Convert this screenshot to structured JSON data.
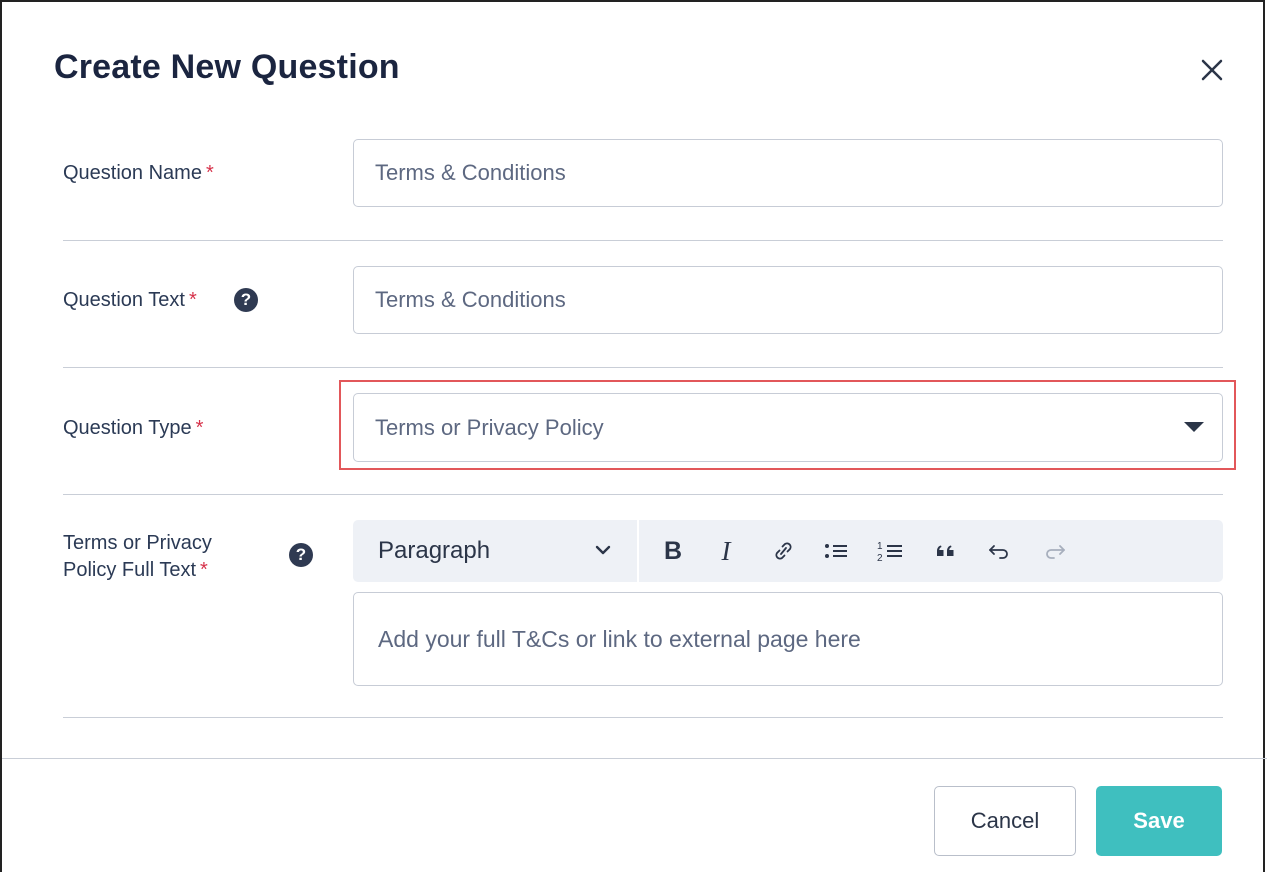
{
  "modal": {
    "title": "Create New Question"
  },
  "fields": {
    "question_name": {
      "label": "Question Name",
      "required": "*",
      "value": "Terms & Conditions"
    },
    "question_text": {
      "label": "Question Text",
      "required": "*",
      "help": "?",
      "value": "Terms & Conditions"
    },
    "question_type": {
      "label": "Question Type",
      "required": "*",
      "value": "Terms or Privacy Policy"
    },
    "full_text": {
      "label_line1": "Terms or Privacy",
      "label_line2": "Policy Full Text",
      "required": "*",
      "help": "?",
      "placeholder": "Add your full T&Cs or link to external page here"
    }
  },
  "toolbar": {
    "block_format": "Paragraph",
    "bold": "B",
    "italic": "I",
    "icons": [
      "chevron-down-icon",
      "bold-icon",
      "italic-icon",
      "link-icon",
      "bulleted-list-icon",
      "numbered-list-icon",
      "block-quote-icon",
      "undo-icon",
      "redo-icon"
    ]
  },
  "footer": {
    "cancel_label": "Cancel",
    "save_label": "Save"
  },
  "colors": {
    "accent": "#3fbfbf",
    "required": "#d6324a",
    "highlight": "#e2575a",
    "title": "#1b2540"
  }
}
